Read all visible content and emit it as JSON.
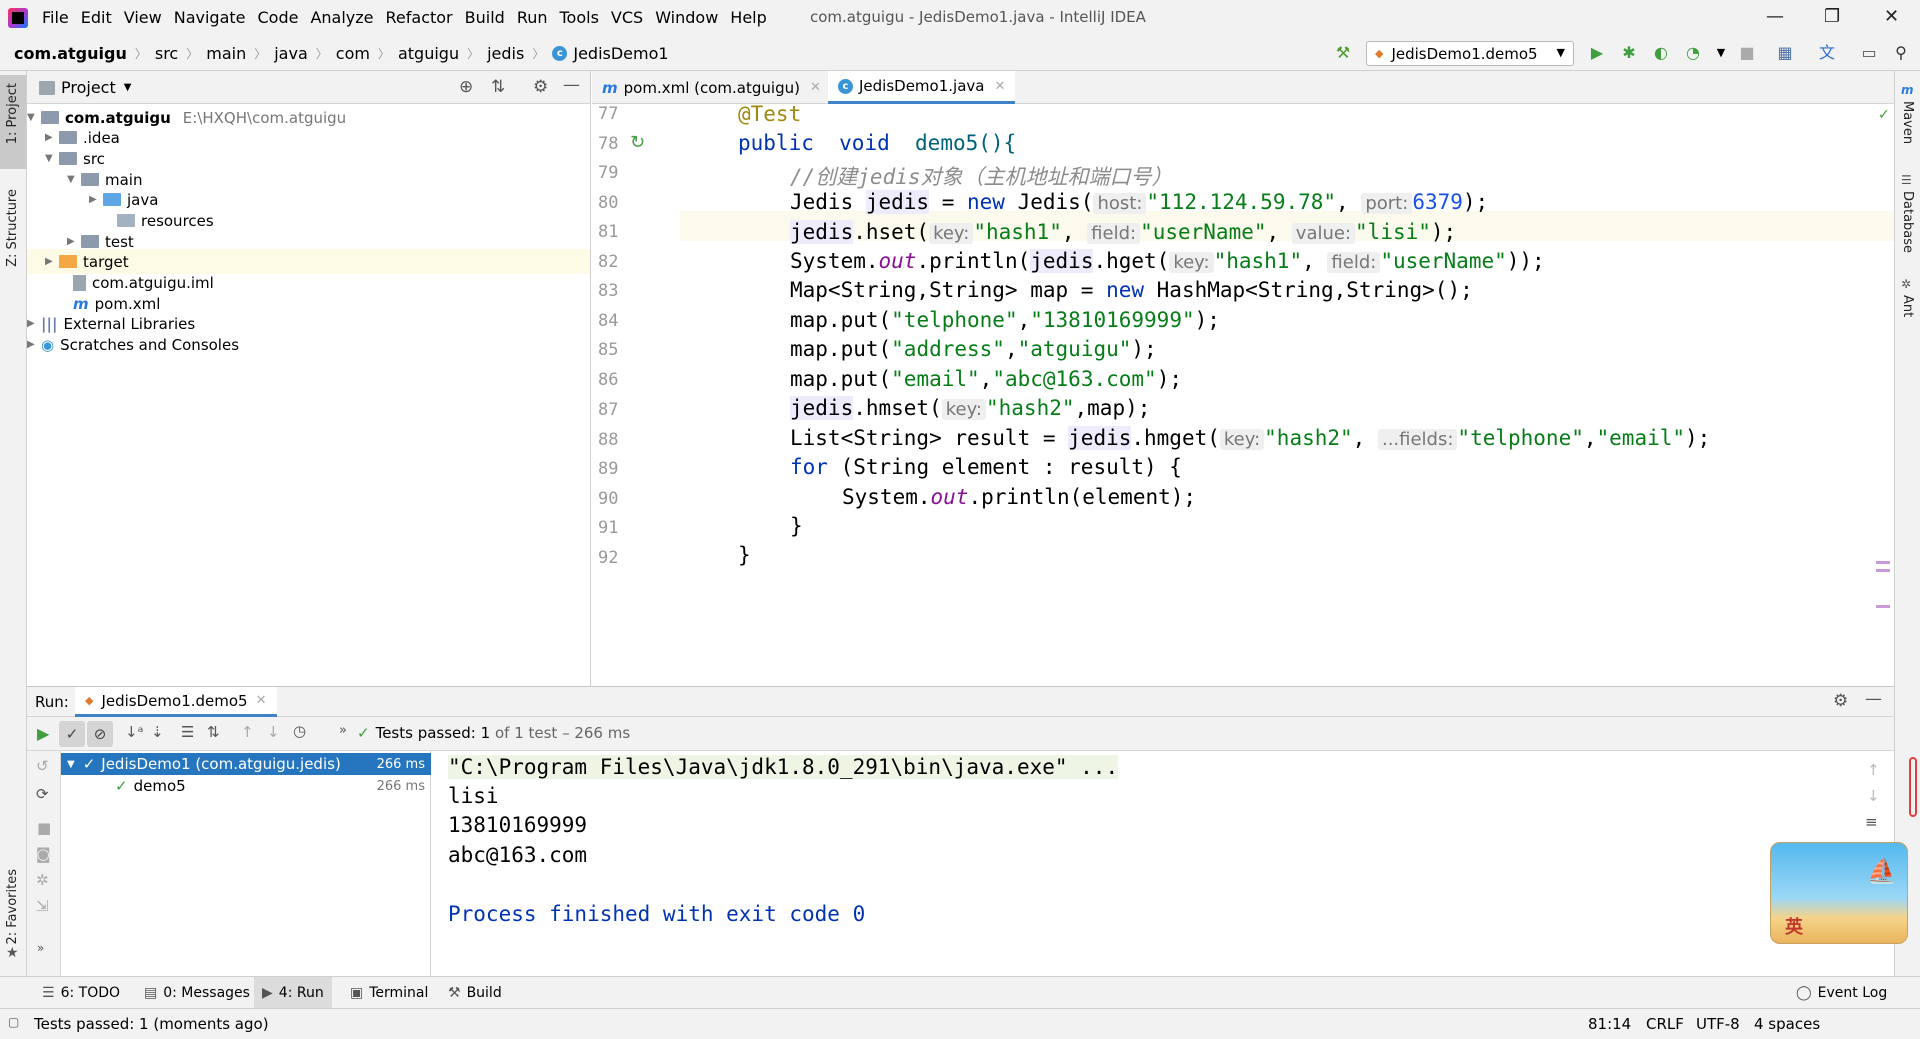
{
  "menubar": {
    "items": [
      "File",
      "Edit",
      "View",
      "Navigate",
      "Code",
      "Analyze",
      "Refactor",
      "Build",
      "Run",
      "Tools",
      "VCS",
      "Window",
      "Help"
    ],
    "title": "com.atguigu - JedisDemo1.java - IntelliJ IDEA"
  },
  "navbar": {
    "crumbs": [
      "com.atguigu",
      "src",
      "main",
      "java",
      "com",
      "atguigu",
      "jedis",
      "JedisDemo1"
    ],
    "run_config": "JedisDemo1.demo5"
  },
  "leftstrip": {
    "project": "1: Project",
    "structure": "Z: Structure",
    "favorites": "2: Favorites"
  },
  "rightstrip": {
    "maven": "Maven",
    "database": "Database",
    "ant": "Ant"
  },
  "project": {
    "title": "Project",
    "tree": [
      {
        "label": "com.atguigu",
        "extra": "E:\\HXQH\\com.atguigu"
      },
      {
        "label": ".idea"
      },
      {
        "label": "src"
      },
      {
        "label": "main"
      },
      {
        "label": "java"
      },
      {
        "label": "resources"
      },
      {
        "label": "test"
      },
      {
        "label": "target"
      },
      {
        "label": "com.atguigu.iml"
      },
      {
        "label": "pom.xml"
      },
      {
        "label": "External Libraries"
      },
      {
        "label": "Scratches and Consoles"
      }
    ]
  },
  "editor": {
    "tabs": [
      "pom.xml (com.atguigu)",
      "JedisDemo1.java"
    ],
    "line_numbers": [
      "77",
      "78",
      "79",
      "80",
      "81",
      "82",
      "83",
      "84",
      "85",
      "86",
      "87",
      "88",
      "89",
      "90",
      "91",
      "92"
    ],
    "hints": {
      "host": "host:",
      "port": "port:",
      "key": "key:",
      "field": "field:",
      "value": "value:",
      "fields": "...fields:"
    },
    "code": {
      "l77": "@Test",
      "l78_kw1": "public",
      "l78_kw2": "void",
      "l78_rest": "demo5(){",
      "l79": "//创建jedis对象（主机地址和端口号）",
      "l80_a": "Jedis ",
      "l80_b": "jedis",
      "l80_c": " = ",
      "l80_d": "new",
      "l80_e": " Jedis(",
      "l80_f": "\"112.124.59.78\"",
      "l80_g": ", ",
      "l80_h": "6379",
      "l80_i": ");",
      "l81_a": "jedis",
      "l81_b": ".hset(",
      "l81_c": "\"hash1\"",
      "l81_d": ", ",
      "l81_e": "\"userName\"",
      "l81_f": ", ",
      "l81_g": "\"lisi\"",
      "l81_h": ");",
      "l82_a": "System.",
      "l82_b": "out",
      "l82_c": ".println(",
      "l82_d": "jedis",
      "l82_e": ".hget(",
      "l82_f": "\"hash1\"",
      "l82_g": ", ",
      "l82_h": "\"userName\"",
      "l82_i": "));",
      "l83_a": "Map<String,String> map = ",
      "l83_b": "new",
      "l83_c": " HashMap<String,String>();",
      "l84_a": "map.put(",
      "l84_b": "\"telphone\"",
      "l84_c": ",",
      "l84_d": "\"13810169999\"",
      "l84_e": ");",
      "l85_a": "map.put(",
      "l85_b": "\"address\"",
      "l85_c": ",",
      "l85_d": "\"atguigu\"",
      "l85_e": ");",
      "l86_a": "map.put(",
      "l86_b": "\"email\"",
      "l86_c": ",",
      "l86_d": "\"abc@163.com\"",
      "l86_e": ");",
      "l87_a": "jedis",
      "l87_b": ".hmset(",
      "l87_c": "\"hash2\"",
      "l87_d": ",map);",
      "l88_a": "List<String> result = ",
      "l88_b": "jedis",
      "l88_c": ".hmget(",
      "l88_d": "\"hash2\"",
      "l88_e": ", ",
      "l88_f": "\"telphone\"",
      "l88_g": ",",
      "l88_h": "\"email\"",
      "l88_i": ");",
      "l89_a": "for",
      "l89_b": " (String element : result) {",
      "l90_a": "System.",
      "l90_b": "out",
      "l90_c": ".println(element);",
      "l91": "}",
      "l92": "}"
    }
  },
  "run": {
    "label": "Run:",
    "tab": "JedisDemo1.demo5",
    "status_prefix": "Tests passed:",
    "status_count": "1",
    "status_suffix": "of 1 test – 266 ms",
    "tree": [
      {
        "label": "JedisDemo1 (com.atguigu.jedis)",
        "time": "266 ms"
      },
      {
        "label": "demo5",
        "time": "266 ms"
      }
    ],
    "console": [
      "\"C:\\Program Files\\Java\\jdk1.8.0_291\\bin\\java.exe\" ...",
      "lisi",
      "13810169999",
      "abc@163.com",
      "",
      "Process finished with exit code 0"
    ]
  },
  "bottom_tabs": [
    "6: TODO",
    "0: Messages",
    "4: Run",
    "Terminal",
    "Build"
  ],
  "event_log": "Event Log",
  "statusbar": {
    "message": "Tests passed: 1 (moments ago)",
    "position": "81:14",
    "line_sep": "CRLF",
    "encoding": "UTF-8",
    "indent": "4 spaces"
  },
  "ime": {
    "label": "英"
  },
  "colors": {
    "accent": "#4083c9",
    "keyword": "#0033b3",
    "string": "#067d17",
    "annotation": "#9e880d",
    "success": "#3f9e3f"
  }
}
